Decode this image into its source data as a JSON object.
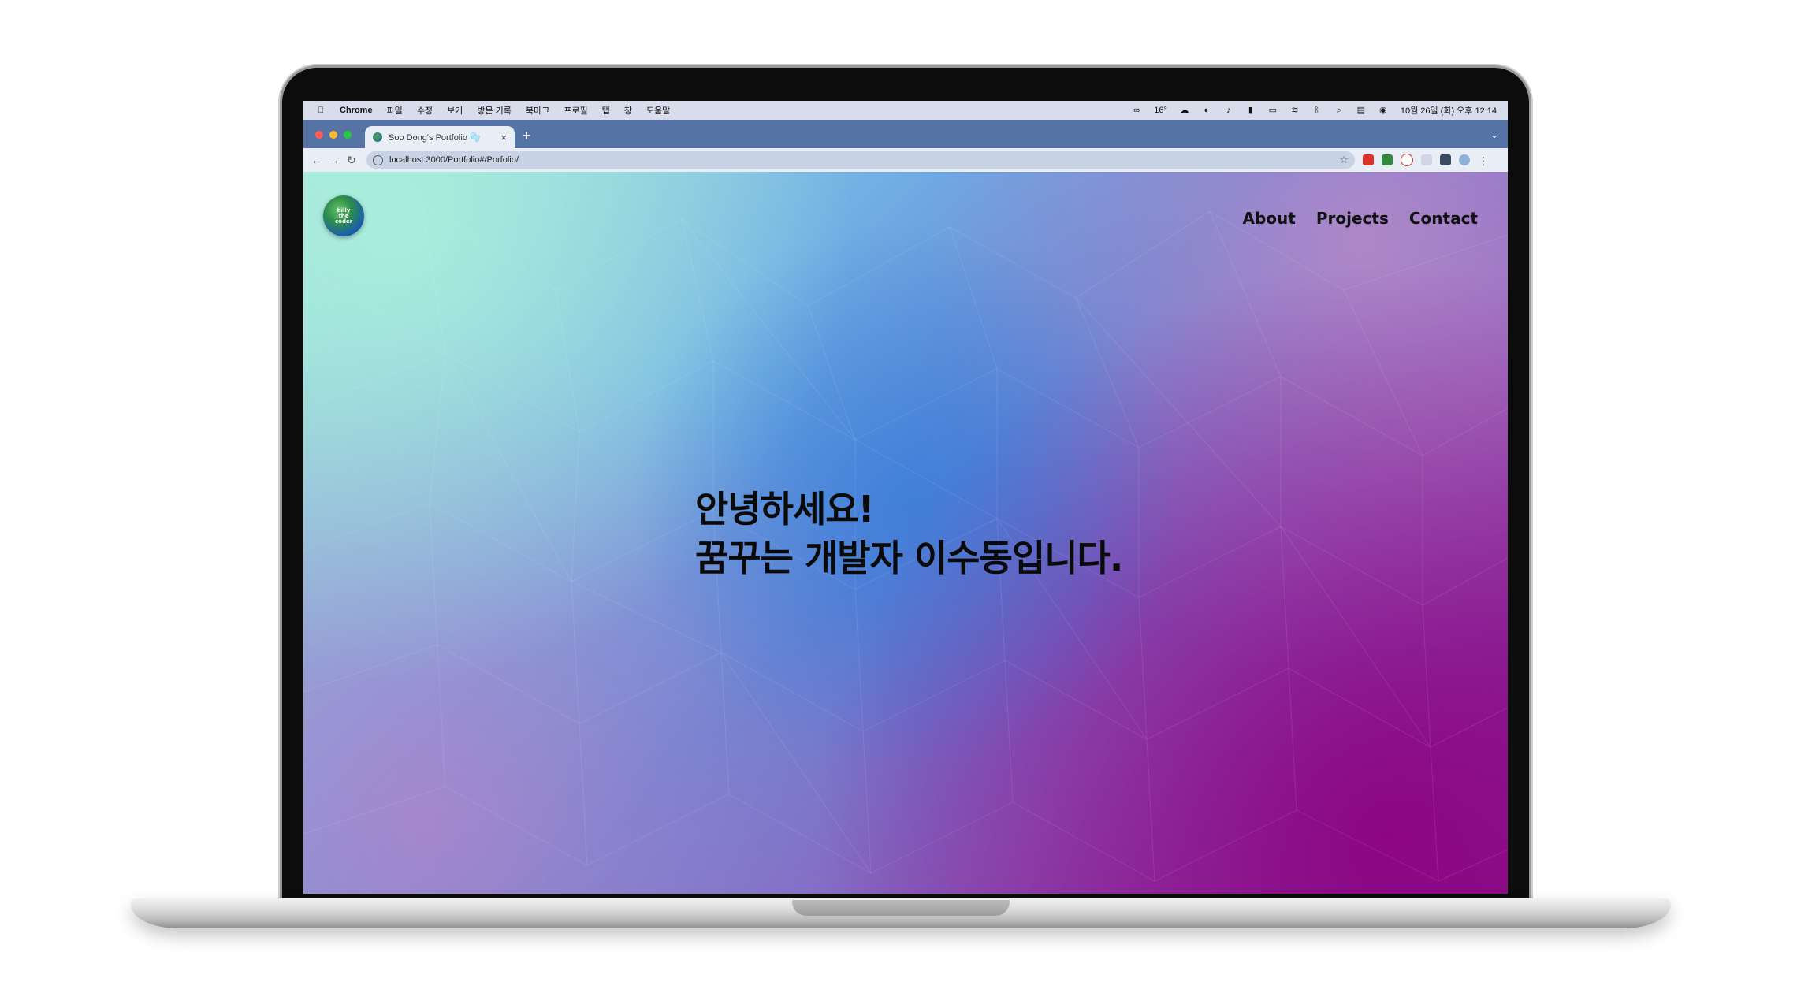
{
  "menubar": {
    "apple_icon": "apple-icon",
    "app_name": "Chrome",
    "menus": [
      "파일",
      "수정",
      "보기",
      "방문 기록",
      "북마크",
      "프로필",
      "탭",
      "창",
      "도움말"
    ],
    "temperature": "16°",
    "datetime": "10월 26일 (화) 오후 12:14"
  },
  "browser": {
    "tab_title": "Soo Dong's Portfolio 🫧",
    "new_tab": "+",
    "url": "localhost:3000/Portfolio#/Porfolio/"
  },
  "site": {
    "logo_text": "billy the coder",
    "nav": [
      "About",
      "Projects",
      "Contact"
    ],
    "hero_line1": "안녕하세요!",
    "hero_line2": "꿈꾸는 개발자 이수동입니다."
  },
  "colors": {
    "tab_strip": "#5573a5",
    "toolbar": "#e8edf6",
    "menubar": "#d8dceb",
    "gradient_start": "#a6e2dc",
    "gradient_mid": "#5f84d4",
    "gradient_end": "#8d1f8d"
  }
}
